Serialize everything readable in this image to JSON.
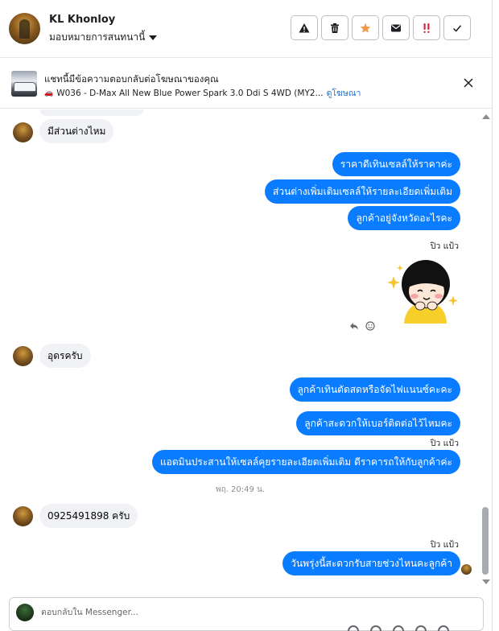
{
  "header": {
    "contact_name": "KL Khonloy",
    "assign_label": "มอบหมายการสนทนานี้",
    "toolbar": [
      {
        "name": "spam-button",
        "icon": "warning-triangle-icon",
        "color": "#1c1e21"
      },
      {
        "name": "delete-button",
        "icon": "trash-icon",
        "color": "#1c1e21"
      },
      {
        "name": "star-button",
        "icon": "star-icon",
        "color": "#f2994a"
      },
      {
        "name": "mark-unread-button",
        "icon": "envelope-icon",
        "color": "#1c1e21"
      },
      {
        "name": "follow-up-button",
        "icon": "double-exclamation-icon",
        "color": "#e41e3f"
      },
      {
        "name": "mark-done-button",
        "icon": "checkmark-icon",
        "color": "#1c1e21"
      }
    ]
  },
  "ad": {
    "title": "แชทนี้มีข้อความตอบกลับต่อโฆษณาของคุณ",
    "subtitle": "W036 - D-Max All New Blue Power Spark 3.0 Ddi S 4WD (MY2...",
    "link": "ดูโฆษณา"
  },
  "messages": {
    "m1": "มีส่วนต่างไหม",
    "o1": "ราคาดีเทินเซลล์ให้ราคาค่ะ",
    "o2": "ส่วนต่างเพิ่มเติมเซลล์ให้รายละเอียดเพิ่มเติม",
    "o3": "ลูกค้าอยู่จังหวัดอะไรคะ",
    "sender1": "ปิว แป้ว",
    "m2": "อุดรครับ",
    "o4": "ลูกค้าเทินตัดสดหรือจัดไฟแนนซ์คะคะ",
    "o5": "ลูกค้าสะดวกให้เบอร์ติดต่อไว้ไหมคะ",
    "sender2": "ปิว แป้ว",
    "o6": "แอดมินประสานให้เซลล์คุยรายละเอียดเพิ่มเติม ดีราคารถให้กับลูกค้าค่ะ",
    "timestamp": "พฤ. 20:49 น.",
    "m3": "0925491898 ครับ",
    "sender3": "ปิว แป้ว",
    "o7": "วันพรุ่งนี้สะดวกรับสายช่วงไหนคะลูกค้า"
  },
  "composer": {
    "placeholder": "ตอบกลับใน Messenger..."
  },
  "colors": {
    "outgoing_bubble": "#0a7cff",
    "incoming_bubble": "#f0f2f5",
    "link": "#1e6ccf"
  }
}
